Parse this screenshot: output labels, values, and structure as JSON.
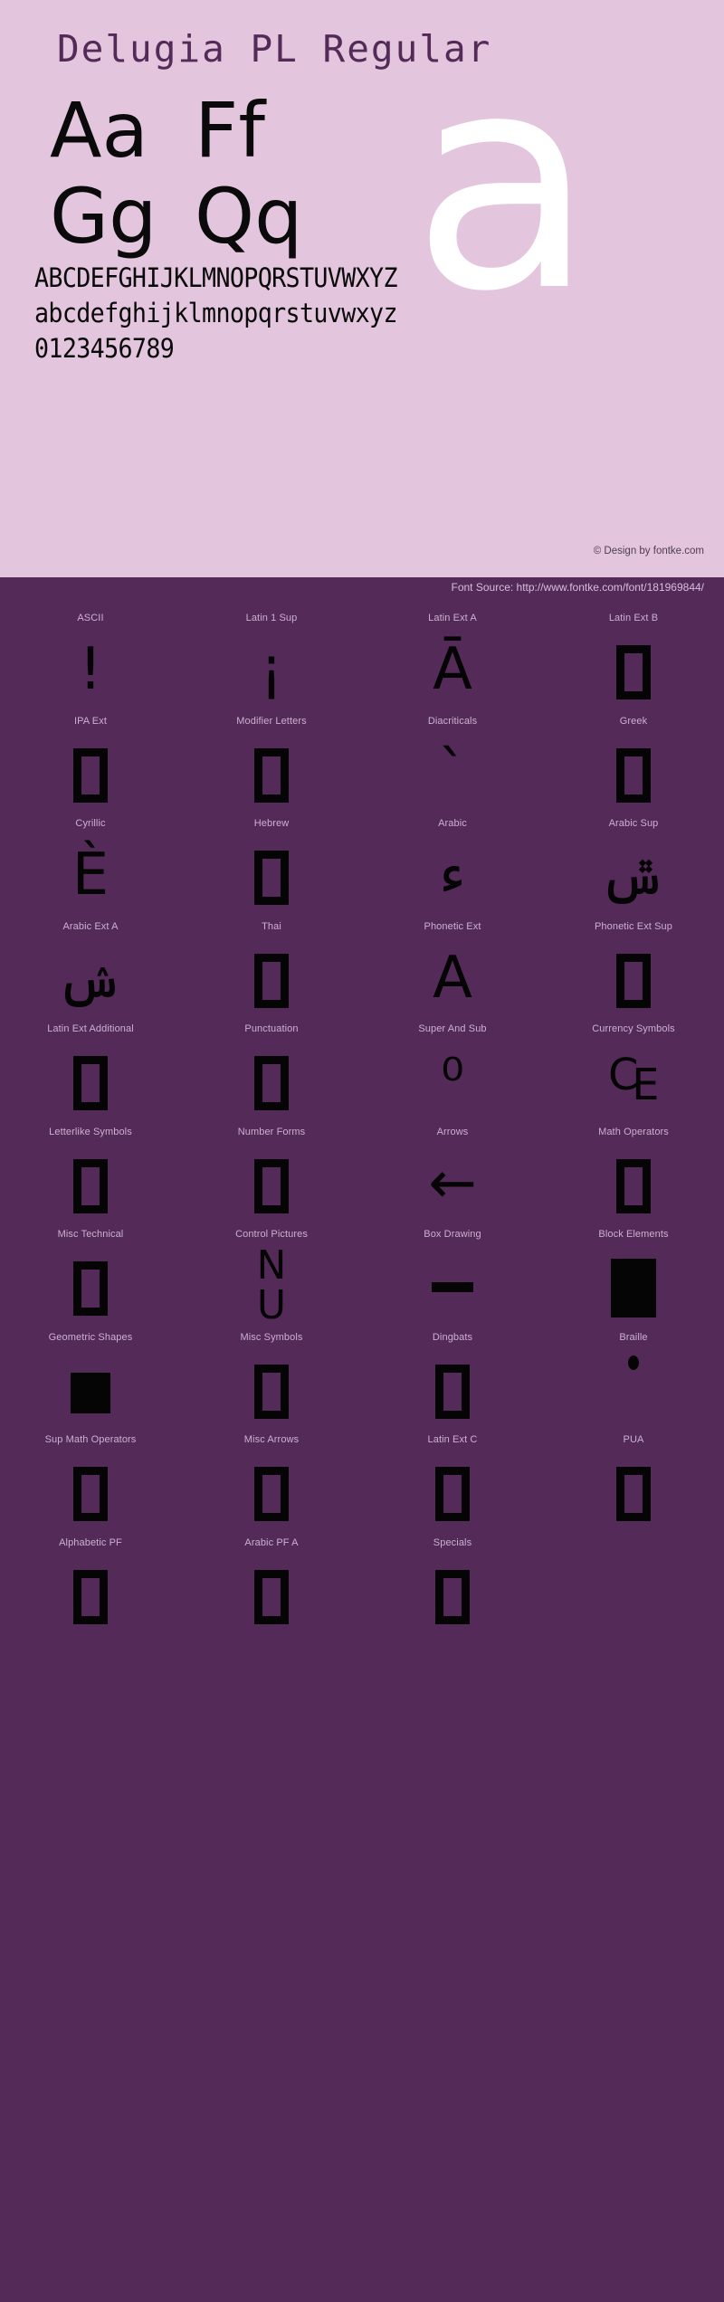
{
  "hero": {
    "title": "Delugia PL Regular",
    "giant_letter": "a",
    "pairs": [
      [
        "Aa",
        "Ff"
      ],
      [
        "Gg",
        "Qq"
      ]
    ],
    "alphabet_lines": [
      "ABCDEFGHIJKLMNOPQRSTUVWXYZ",
      "abcdefghijklmnopqrstuvwxyz",
      "0123456789"
    ],
    "copyright": "© Design by fontke.com",
    "background_color": "#e3c6dd",
    "title_color": "#542a58"
  },
  "source_bar": {
    "text": "Font Source: http://www.fontke.com/font/181969844/"
  },
  "blocks": {
    "background_color": "#542a58",
    "label_color": "#cbb1d1",
    "rows": [
      [
        {
          "label": "ASCII",
          "sample": "!",
          "kind": "glyph"
        },
        {
          "label": "Latin 1 Sup",
          "sample": "¡",
          "kind": "glyph"
        },
        {
          "label": "Latin Ext A",
          "sample": "Ā",
          "kind": "glyph"
        },
        {
          "label": "Latin Ext B",
          "sample": "",
          "kind": "tofu"
        }
      ],
      [
        {
          "label": "IPA Ext",
          "sample": "",
          "kind": "tofu"
        },
        {
          "label": "Modifier Letters",
          "sample": "",
          "kind": "tofu"
        },
        {
          "label": "Diacriticals",
          "sample": "ˋ",
          "kind": "glyph"
        },
        {
          "label": "Greek",
          "sample": "",
          "kind": "tofu"
        }
      ],
      [
        {
          "label": "Cyrillic",
          "sample": "È",
          "kind": "glyph"
        },
        {
          "label": "Hebrew",
          "sample": "",
          "kind": "tofu"
        },
        {
          "label": "Arabic",
          "sample": "ء",
          "kind": "glyph"
        },
        {
          "label": "Arabic Sup",
          "sample": "ݜ",
          "kind": "glyph"
        }
      ],
      [
        {
          "label": "Arabic Ext A",
          "sample": "ݾ",
          "kind": "glyph"
        },
        {
          "label": "Thai",
          "sample": "",
          "kind": "tofu"
        },
        {
          "label": "Phonetic Ext",
          "sample": "A",
          "kind": "glyph"
        },
        {
          "label": "Phonetic Ext Sup",
          "sample": "",
          "kind": "tofu"
        }
      ],
      [
        {
          "label": "Latin Ext Additional",
          "sample": "",
          "kind": "tofu"
        },
        {
          "label": "Punctuation",
          "sample": "",
          "kind": "tofu"
        },
        {
          "label": "Super And Sub",
          "sample": "⁰",
          "kind": "glyph"
        },
        {
          "label": "Currency Symbols",
          "sample": "₠",
          "kind": "glyph"
        }
      ],
      [
        {
          "label": "Letterlike Symbols",
          "sample": "",
          "kind": "tofu"
        },
        {
          "label": "Number Forms",
          "sample": "",
          "kind": "tofu"
        },
        {
          "label": "Arrows",
          "sample": "←",
          "kind": "glyph"
        },
        {
          "label": "Math Operators",
          "sample": "",
          "kind": "tofu"
        }
      ],
      [
        {
          "label": "Misc Technical",
          "sample": "",
          "kind": "tofu"
        },
        {
          "label": "Control Pictures",
          "sample": "␢",
          "kind": "stack"
        },
        {
          "label": "Box Drawing",
          "sample": "",
          "kind": "dash"
        },
        {
          "label": "Block Elements",
          "sample": "",
          "kind": "solid"
        }
      ],
      [
        {
          "label": "Geometric Shapes",
          "sample": "",
          "kind": "square"
        },
        {
          "label": "Misc Symbols",
          "sample": "",
          "kind": "tofu"
        },
        {
          "label": "Dingbats",
          "sample": "",
          "kind": "tofu"
        },
        {
          "label": "Braille",
          "sample": "⠁",
          "kind": "dot"
        }
      ],
      [
        {
          "label": "Sup Math Operators",
          "sample": "",
          "kind": "tofu"
        },
        {
          "label": "Misc Arrows",
          "sample": "",
          "kind": "tofu"
        },
        {
          "label": "Latin Ext C",
          "sample": "",
          "kind": "tofu"
        },
        {
          "label": "PUA",
          "sample": "",
          "kind": "tofu"
        }
      ],
      [
        {
          "label": "Alphabetic PF",
          "sample": "",
          "kind": "tofu"
        },
        {
          "label": "Arabic PF A",
          "sample": "",
          "kind": "tofu"
        },
        {
          "label": "Specials",
          "sample": "",
          "kind": "tofu"
        },
        {
          "label": "",
          "sample": "",
          "kind": "none"
        }
      ]
    ]
  }
}
